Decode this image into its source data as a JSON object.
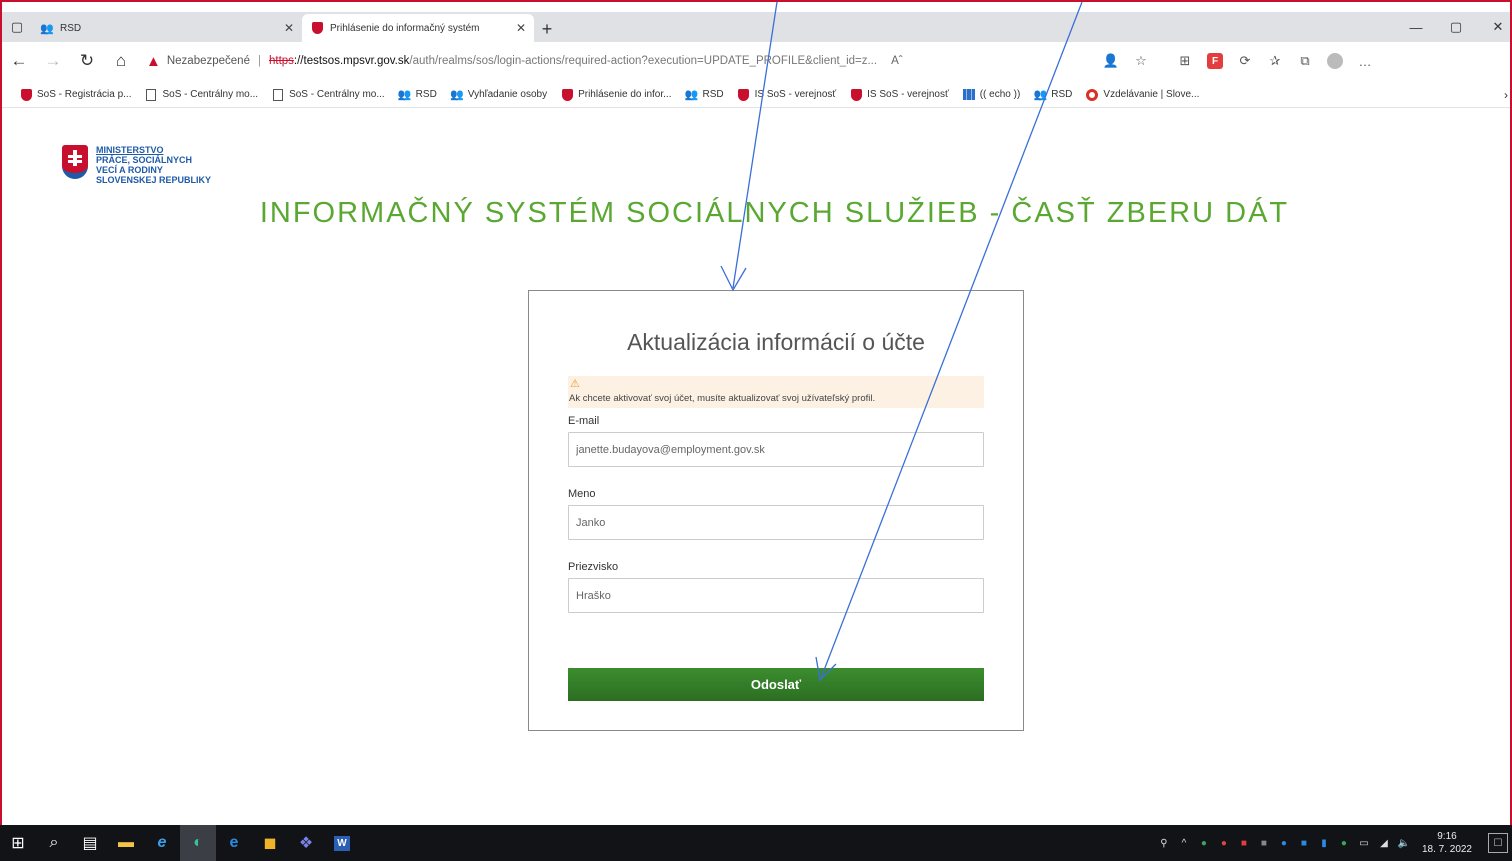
{
  "browser": {
    "tabs": [
      {
        "title": "RSD"
      },
      {
        "title": "Prihlásenie do informačný systém"
      }
    ],
    "address": {
      "security_label": "Nezabezpečené",
      "protocol": "https",
      "host": "://testsos.mpsvr.gov.sk",
      "path": "/auth/realms/sos/login-actions/required-action?execution=UPDATE_PROFILE&client_id=z..."
    },
    "favorites": [
      {
        "label": "SoS - Registrácia p...",
        "icon": "shield-icon"
      },
      {
        "label": "SoS - Centrálny mo...",
        "icon": "document-icon"
      },
      {
        "label": "SoS - Centrálny mo...",
        "icon": "document-icon"
      },
      {
        "label": "RSD",
        "icon": "people-icon"
      },
      {
        "label": "Vyhľadanie osoby",
        "icon": "people-icon"
      },
      {
        "label": "Prihlásenie do infor...",
        "icon": "shield-icon"
      },
      {
        "label": "RSD",
        "icon": "people-icon"
      },
      {
        "label": "IS SoS - verejnosť",
        "icon": "shield-icon"
      },
      {
        "label": "IS SoS - verejnosť",
        "icon": "shield-icon"
      },
      {
        "label": "(( echo ))",
        "icon": "chart-icon"
      },
      {
        "label": "RSD",
        "icon": "people-icon"
      },
      {
        "label": "Vzdelávanie | Slove...",
        "icon": "ring-icon"
      }
    ]
  },
  "page": {
    "logo_lines": [
      "MINISTERSTVO",
      "PRÁCE, SOCIÁLNYCH",
      "VECÍ A RODINY",
      "SLOVENSKEJ REPUBLIKY"
    ],
    "title": "INFORMAČNÝ SYSTÉM SOCIÁLNYCH SLUŽIEB - ČASŤ ZBERU DÁT",
    "form": {
      "heading": "Aktualizácia informácií o účte",
      "alert": "Ak chcete aktivovať svoj účet, musíte aktualizovať svoj užívateľský profil.",
      "email_label": "E-mail",
      "email_value": "janette.budayova@employment.gov.sk",
      "first_name_label": "Meno",
      "first_name_value": "Janko",
      "last_name_label": "Priezvisko",
      "last_name_value": "Hraško",
      "submit_label": "Odoslať"
    }
  },
  "taskbar": {
    "time": "9:16",
    "date": "18. 7. 2022"
  },
  "colors": {
    "accent_green": "#5aa832",
    "button_green": "#2c6e22",
    "annotation_blue": "#3a6fd8",
    "frame_red": "#c8102e"
  }
}
